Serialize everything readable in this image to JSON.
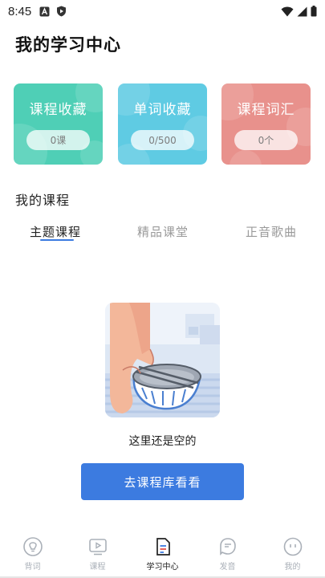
{
  "status_bar": {
    "time": "8:45",
    "left_icons": [
      "a-badge-icon",
      "shield-play-icon"
    ],
    "right_icons": [
      "wifi-icon",
      "signal-icon",
      "battery-icon"
    ]
  },
  "header": {
    "title": "我的学习中心"
  },
  "cards": [
    {
      "title": "课程收藏",
      "value": "0课",
      "color": "#4fcfb6"
    },
    {
      "title": "单词收藏",
      "value": "0/500",
      "color": "#5fcbe3"
    },
    {
      "title": "课程词汇",
      "value": "0个",
      "color": "#e8918c"
    }
  ],
  "courses": {
    "section_title": "我的课程",
    "tabs": [
      {
        "label": "主题课程",
        "active": true
      },
      {
        "label": "精品课堂",
        "active": false
      },
      {
        "label": "正音歌曲",
        "active": false
      }
    ]
  },
  "empty_state": {
    "illustration": "empty-bowl-illustration",
    "message": "这里还是空的",
    "button_label": "去课程库看看"
  },
  "bottom_nav": [
    {
      "label": "背词",
      "icon": "lightbulb-icon",
      "active": false
    },
    {
      "label": "课程",
      "icon": "play-screen-icon",
      "active": false
    },
    {
      "label": "学习中心",
      "icon": "document-icon",
      "active": true
    },
    {
      "label": "发音",
      "icon": "speech-icon",
      "active": false
    },
    {
      "label": "我的",
      "icon": "smiley-icon",
      "active": false
    }
  ],
  "colors": {
    "accent": "#3c7be0",
    "nav_inactive": "#aab0b8"
  }
}
